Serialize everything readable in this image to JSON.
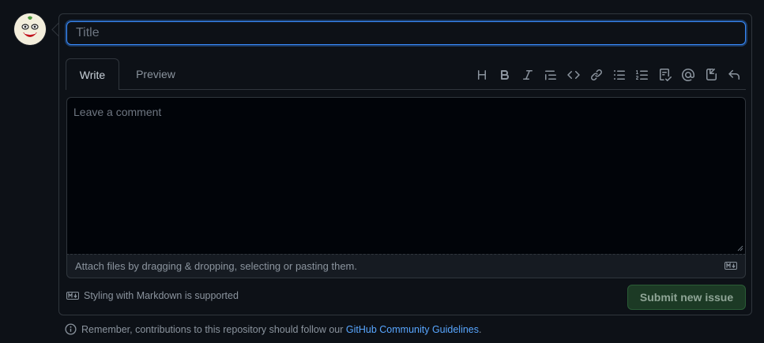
{
  "form": {
    "title_placeholder": "Title",
    "tabs": [
      {
        "label": "Write",
        "active": true
      },
      {
        "label": "Preview",
        "active": false
      }
    ],
    "toolbar": [
      {
        "name": "heading-icon"
      },
      {
        "name": "bold-icon"
      },
      {
        "name": "italic-icon"
      },
      {
        "name": "quote-icon"
      },
      {
        "name": "code-icon"
      },
      {
        "name": "link-icon"
      },
      {
        "name": "bulleted-list-icon"
      },
      {
        "name": "numbered-list-icon"
      },
      {
        "name": "task-list-icon"
      },
      {
        "name": "mention-icon"
      },
      {
        "name": "cross-reference-icon"
      },
      {
        "name": "saved-replies-icon"
      }
    ],
    "comment_placeholder": "Leave a comment",
    "attach_text": "Attach files by dragging & dropping, selecting or pasting them.",
    "markdown_note": "Styling with Markdown is supported",
    "submit_label": "Submit new issue"
  },
  "footer": {
    "prefix": "Remember, contributions to this repository should follow our ",
    "link_text": "GitHub Community Guidelines",
    "suffix": "."
  },
  "colors": {
    "background": "#0d1117",
    "accent_blue": "#388bfd",
    "link": "#58a6ff",
    "submit_bg": "#1c3a25"
  }
}
